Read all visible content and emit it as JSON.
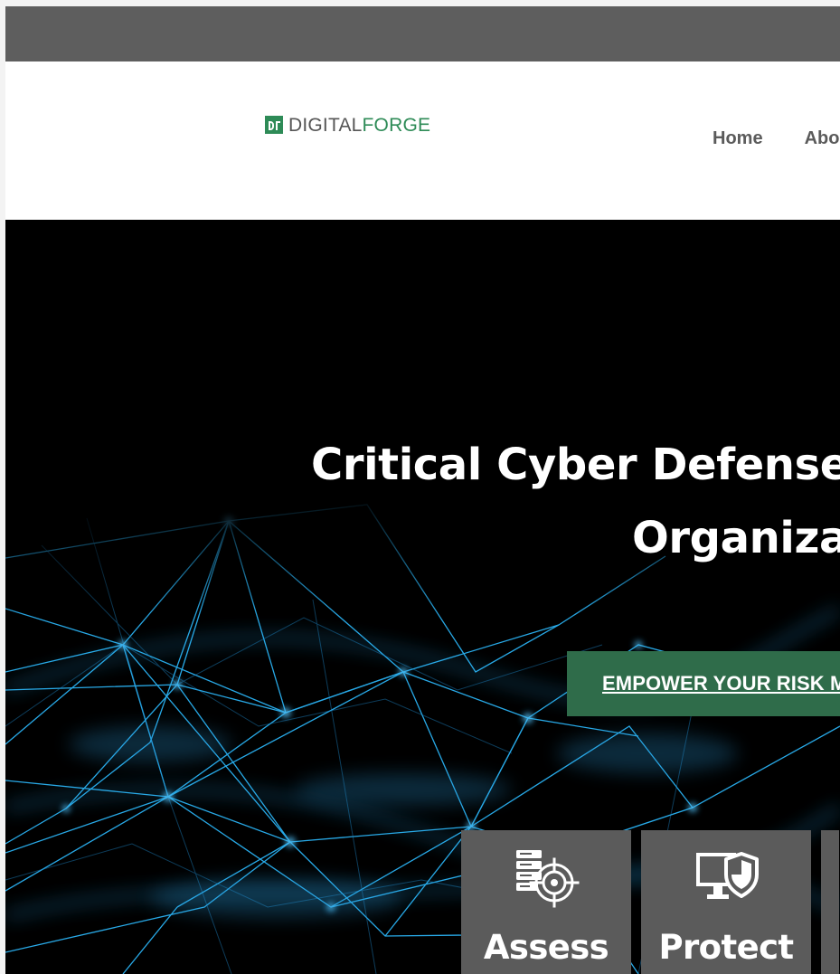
{
  "topbar": {
    "background": "#5e5e5e"
  },
  "brand": {
    "name_part1": "DIGITAL",
    "name_part2": "FORGE",
    "accent": "#2e8b57",
    "text_color": "#555555",
    "icon": "digital-forge-logo-mark"
  },
  "nav": {
    "items": [
      {
        "label": "Home"
      },
      {
        "label": "Abo"
      }
    ],
    "text_color": "#5b5b5b"
  },
  "hero": {
    "title_line1": "Critical Cyber Defenses",
    "title_line2": "Organizat",
    "cta_label": "EMPOWER YOUR RISK MA",
    "cta_color": "#2f6c4a",
    "background_theme": "blue-network-nodes"
  },
  "services": {
    "tiles": [
      {
        "label": "Assess",
        "icon": "server-target-icon"
      },
      {
        "label": "Protect",
        "icon": "monitor-shield-icon"
      },
      {
        "label": "",
        "icon": "partial-tile"
      }
    ],
    "tile_color": "#5b5b5b"
  }
}
